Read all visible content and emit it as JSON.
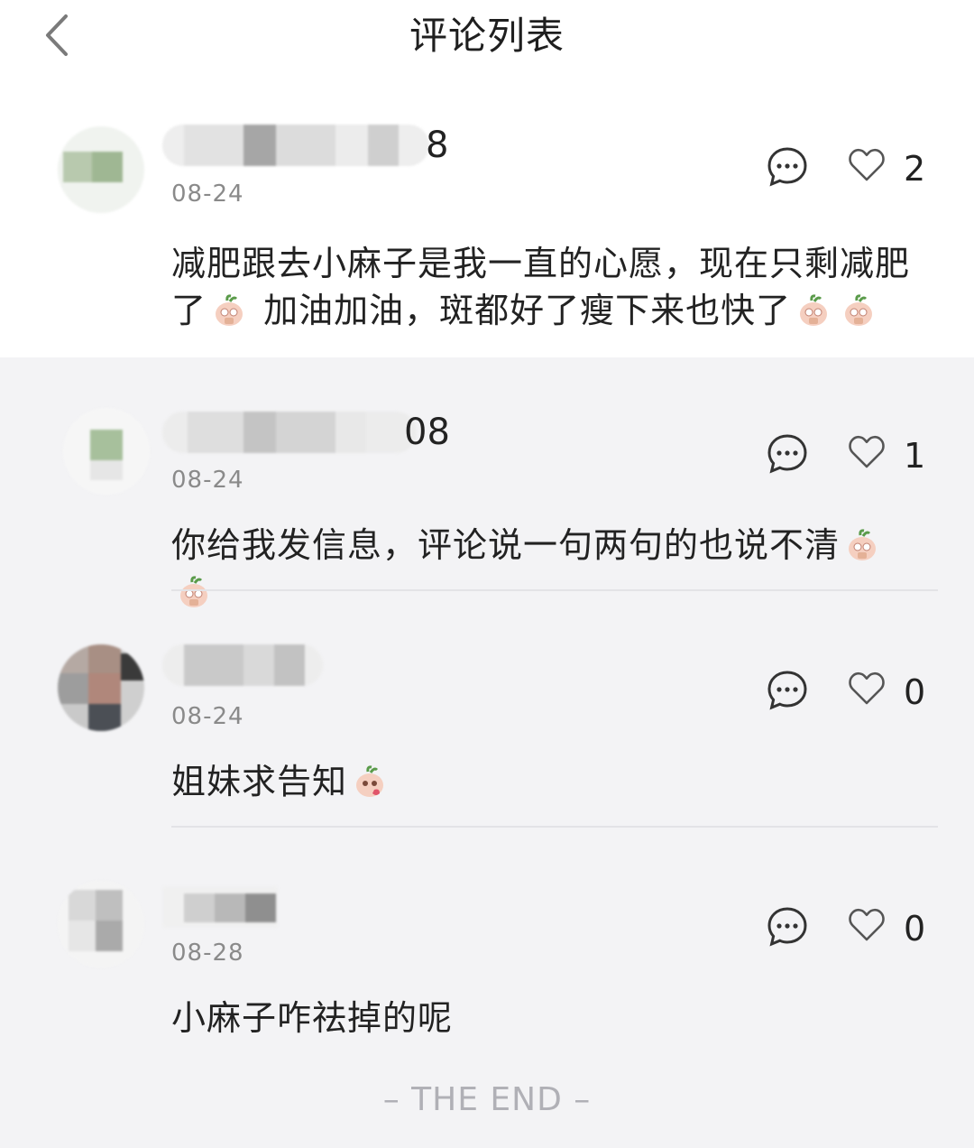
{
  "header": {
    "title": "评论列表"
  },
  "comments": [
    {
      "name_suffix": "8",
      "date": "08-24",
      "likes": "2",
      "text": "减肥跟去小麻子是我一直的心愿，现在只剩减肥了",
      "text_tail": "加油加油，斑都好了瘦下来也快了"
    },
    {
      "name_suffix": "08",
      "date": "08-24",
      "likes": "1",
      "text": "你给我发信息，评论说一句两句的也说不清"
    },
    {
      "name_suffix": "",
      "date": "08-24",
      "likes": "0",
      "text": "姐妹求告知"
    },
    {
      "name_suffix": "",
      "date": "08-28",
      "likes": "0",
      "text": "小麻子咋祛掉的呢"
    }
  ],
  "footer": {
    "end_text": "– THE END –"
  },
  "colors": {
    "text": "#222222",
    "meta": "#8a8a8a",
    "divider": "#e3e3e6",
    "end": "#b0b0b6"
  }
}
